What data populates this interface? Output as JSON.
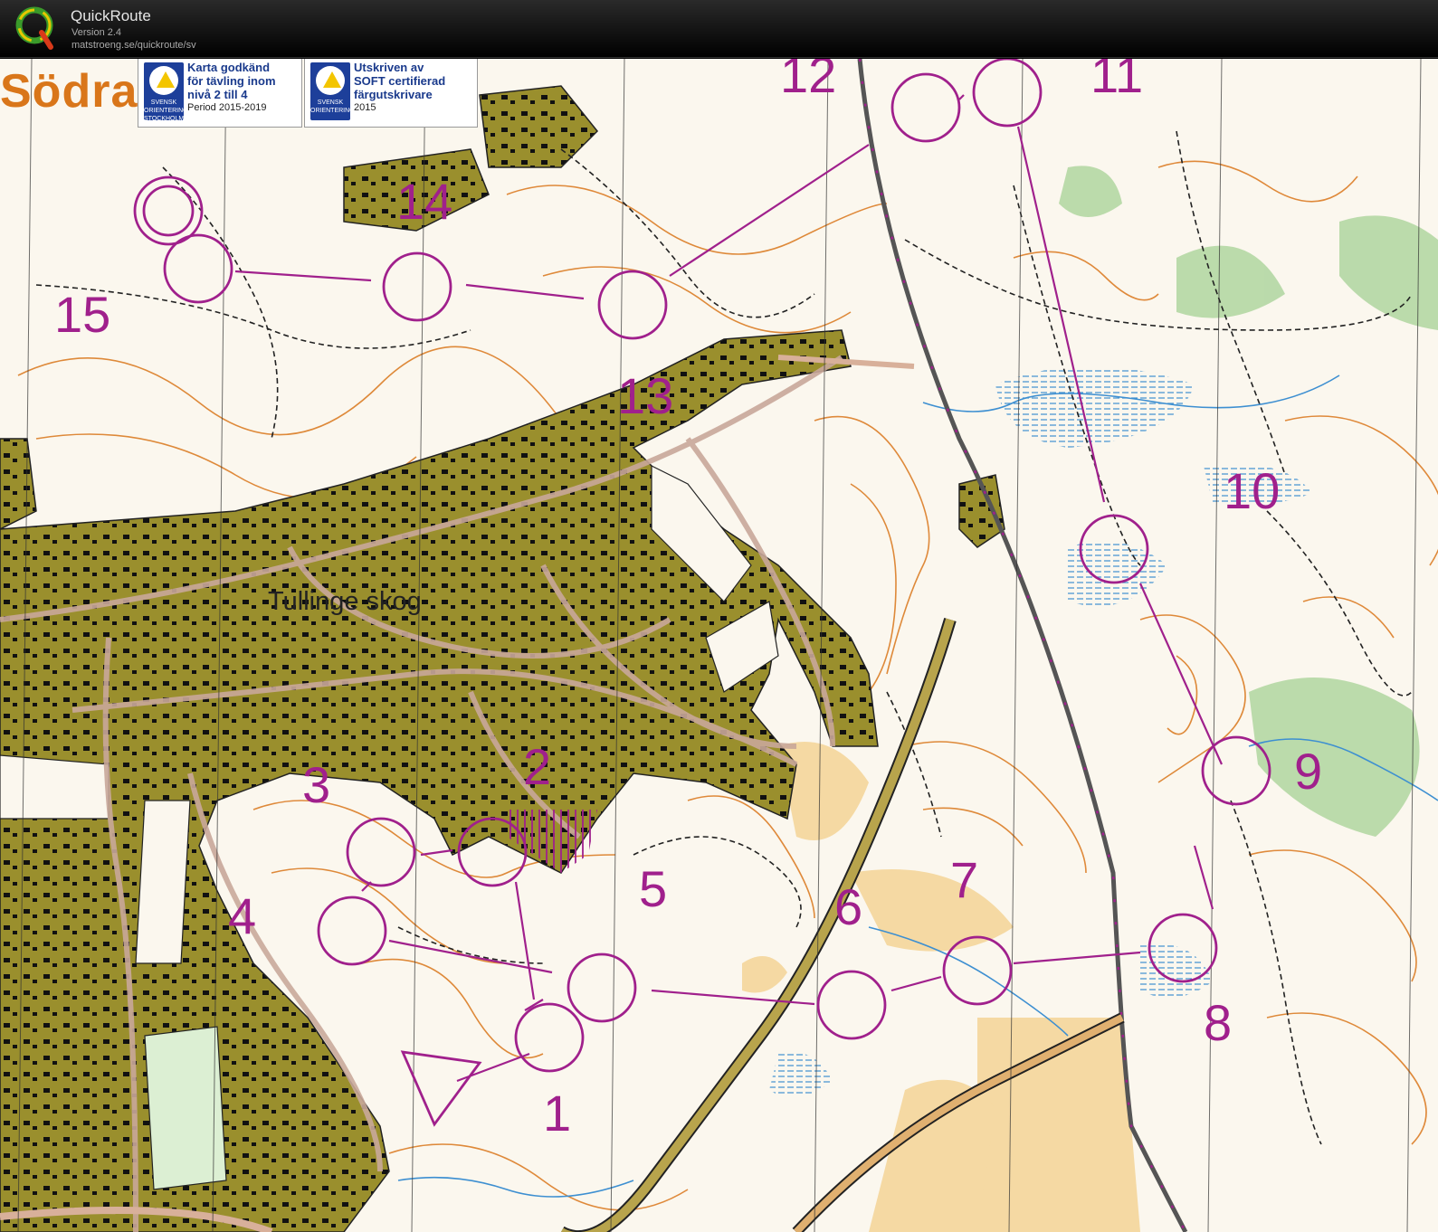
{
  "app": {
    "title": "QuickRoute",
    "version": "Version 2.4",
    "url": "matstroeng.se/quickroute/sv",
    "logo_letter": "Q"
  },
  "map": {
    "area_name": "Södra",
    "place_label": "Tullinge skog",
    "badges": [
      {
        "logo_text": "SVENSK ORIENTERING STOCKHOLM",
        "lines": [
          "Karta godkänd",
          "för tävling inom",
          "nivå 2 till 4"
        ],
        "small": "Period 2015-2019"
      },
      {
        "logo_text": "SVENSK ORIENTERING",
        "lines": [
          "Utskriven av",
          "SOFT certifierad",
          "färgutskrivare"
        ],
        "small": "2015"
      }
    ],
    "controls": [
      "1",
      "2",
      "3",
      "4",
      "5",
      "6",
      "7",
      "8",
      "9",
      "10",
      "11",
      "12",
      "13",
      "14",
      "15"
    ],
    "colors": {
      "course": "#a0208c",
      "settlement": "#9a8f2d",
      "contour": "#d9761a",
      "water": "#3d8fd1",
      "vegetation": "#9fcf8f",
      "background": "#fbf7ee"
    }
  }
}
